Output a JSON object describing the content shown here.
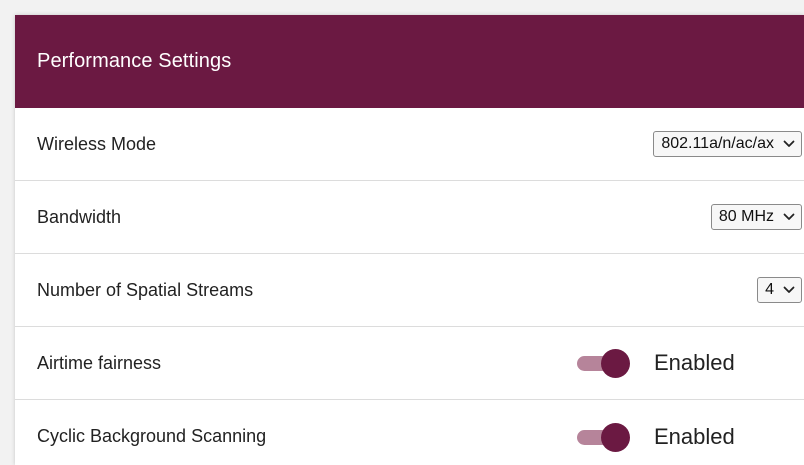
{
  "panel": {
    "title": "Performance Settings"
  },
  "settings": [
    {
      "label": "Wireless Mode",
      "control": "select",
      "value": "802.11a/n/ac/ax"
    },
    {
      "label": "Bandwidth",
      "control": "select",
      "value": "80 MHz"
    },
    {
      "label": "Number of Spatial Streams",
      "control": "select",
      "value": "4"
    },
    {
      "label": "Airtime fairness",
      "control": "toggle",
      "on": true,
      "state_label": "Enabled"
    },
    {
      "label": "Cyclic Background Scanning",
      "control": "toggle",
      "on": true,
      "state_label": "Enabled"
    }
  ],
  "icons": {
    "select_caret": "chevron-down-icon"
  },
  "colors": {
    "brand": "#6b1942",
    "toggle_track": "#b6849a",
    "header_text": "#ffffff"
  }
}
